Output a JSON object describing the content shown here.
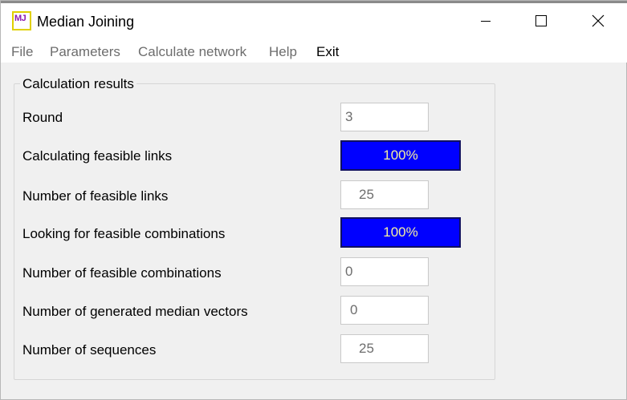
{
  "window": {
    "title": "Median Joining",
    "icon_text": "MJ",
    "icon_name": "median-joining-app-icon"
  },
  "menu": {
    "file": "File",
    "parameters": "Parameters",
    "calculate_network": "Calculate network",
    "help": "Help",
    "exit": "Exit"
  },
  "results": {
    "group_title": "Calculation results",
    "rows": [
      {
        "label": "Round",
        "value": "3"
      },
      {
        "label": "Calculating feasible links",
        "progress": "100%"
      },
      {
        "label": "Number of feasible links",
        "value": "25"
      },
      {
        "label": "Looking for feasible combinations",
        "progress": "100%"
      },
      {
        "label": "Number of feasible combinations",
        "value": "0"
      },
      {
        "label": "Number of generated median vectors",
        "value": "0"
      },
      {
        "label": "Number of sequences",
        "value": "25"
      }
    ]
  },
  "colors": {
    "progress_fill": "#0000ff",
    "progress_text": "#f5f0a0",
    "icon_border": "#e0d000",
    "icon_text": "#8d1bb0"
  }
}
